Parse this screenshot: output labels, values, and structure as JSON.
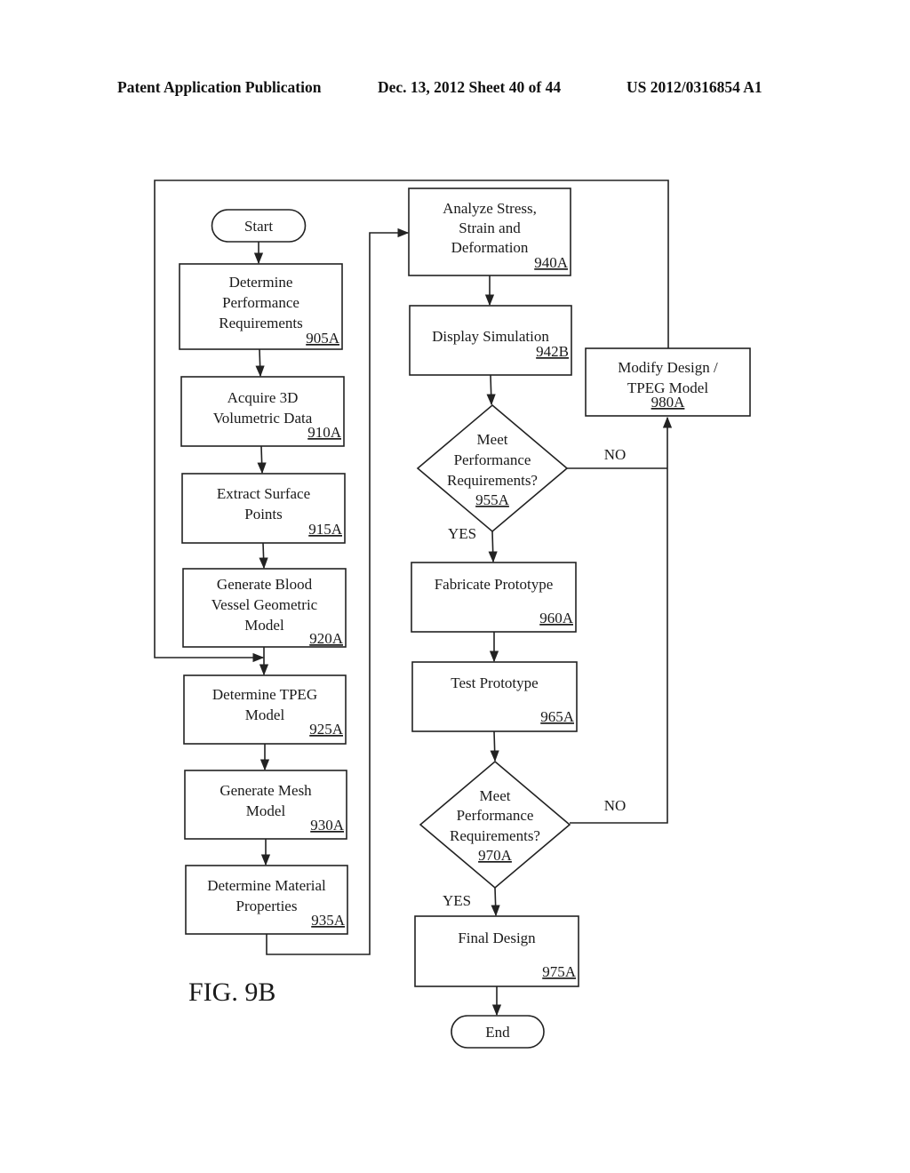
{
  "header": {
    "left": "Patent Application Publication",
    "middle": "Dec. 13, 2012   Sheet 40 of 44",
    "right": "US 2012/0316854 A1"
  },
  "figure_label": "FIG. 9B",
  "flowchart": {
    "start": "Start",
    "end": "End",
    "steps": {
      "s905": {
        "lines": [
          "Determine",
          "Performance",
          "Requirements"
        ],
        "ref": "905A"
      },
      "s910": {
        "lines": [
          "Acquire 3D",
          "Volumetric  Data"
        ],
        "ref": "910A"
      },
      "s915": {
        "lines": [
          "Extract Surface",
          "Points"
        ],
        "ref": "915A"
      },
      "s920": {
        "lines": [
          "Generate Blood",
          "Vessel Geometric",
          "Model"
        ],
        "ref": "920A"
      },
      "s925": {
        "lines": [
          "Determine TPEG",
          "Model"
        ],
        "ref": "925A"
      },
      "s930": {
        "lines": [
          "Generate  Mesh",
          "Model"
        ],
        "ref": "930A"
      },
      "s935": {
        "lines": [
          "Determine Material",
          "Properties"
        ],
        "ref": "935A"
      },
      "s940": {
        "lines": [
          "Analyze Stress,",
          "Strain  and",
          "Deformation"
        ],
        "ref": "940A"
      },
      "s942": {
        "lines": [
          "Display Simulation"
        ],
        "ref": "942B"
      },
      "s960": {
        "lines": [
          "Fabricate Prototype"
        ],
        "ref": "960A"
      },
      "s965": {
        "lines": [
          "Test Prototype"
        ],
        "ref": "965A"
      },
      "s975": {
        "lines": [
          "Final Design"
        ],
        "ref": "975A"
      },
      "s980": {
        "lines": [
          "Modify Design /",
          "TPEG Model"
        ],
        "ref": "980A"
      }
    },
    "decisions": {
      "d955": {
        "lines": [
          "Meet",
          "Performance",
          "Requirements?"
        ],
        "ref": "955A",
        "yes": "YES",
        "no": "NO"
      },
      "d970": {
        "lines": [
          "Meet",
          "Performance",
          "Requirements?"
        ],
        "ref": "970A",
        "yes": "YES",
        "no": "NO"
      }
    }
  }
}
